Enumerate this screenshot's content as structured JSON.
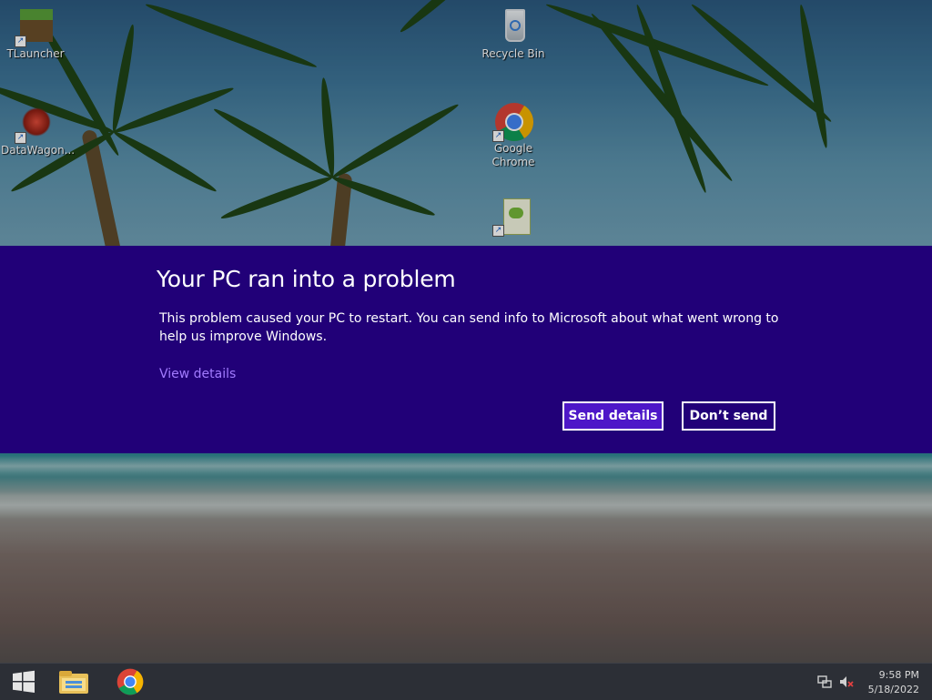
{
  "desktop": {
    "icons": [
      {
        "label": "TLauncher"
      },
      {
        "label": "DataWagon..."
      },
      {
        "label": "Recycle Bin"
      },
      {
        "label": "Google Chrome"
      },
      {
        "label": ""
      }
    ]
  },
  "dialog": {
    "title": "Your PC ran into a problem",
    "message": "This problem caused your PC to restart. You can send info to Microsoft about what went wrong to help us improve Windows.",
    "view_details_link": "View details",
    "send_button": "Send details",
    "dont_send_button": "Don’t send",
    "panel_color": "#210078",
    "primary_button_color": "#4d17c8",
    "link_color": "#a27bff"
  },
  "taskbar": {
    "start_icon": "windows-start-icon",
    "pinned": [
      {
        "icon": "file-explorer-icon"
      },
      {
        "icon": "chrome-icon"
      }
    ],
    "tray": {
      "network_icon": "network-icon",
      "volume_icon": "volume-muted-icon",
      "time": "9:58 PM",
      "date": "5/18/2022"
    }
  }
}
